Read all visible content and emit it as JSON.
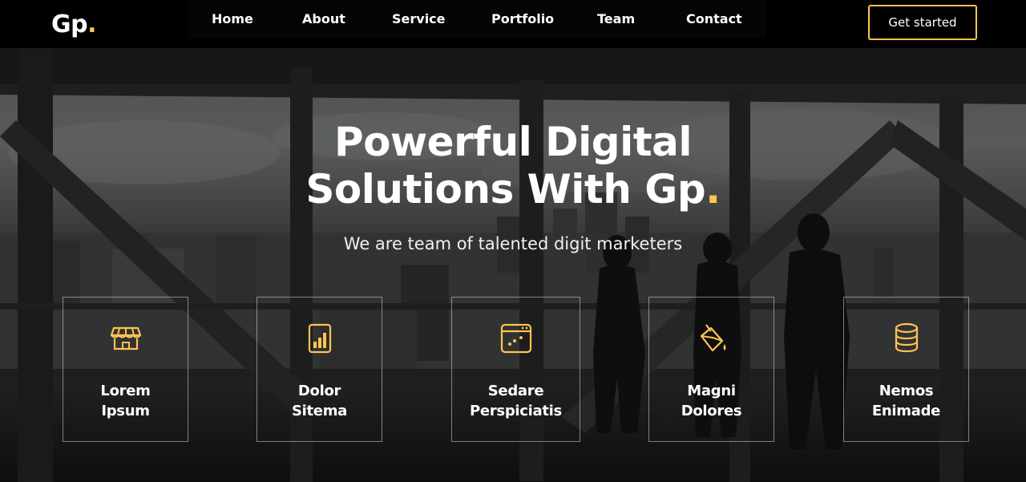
{
  "brand": {
    "logo_text": "Gp",
    "logo_dot": ".",
    "accent_color": "#ffc451"
  },
  "nav": {
    "items": [
      {
        "label": "Home"
      },
      {
        "label": "About"
      },
      {
        "label": "Service"
      },
      {
        "label": "Portfolio"
      },
      {
        "label": "Team"
      },
      {
        "label": "Contact"
      }
    ],
    "cta_label": "Get started"
  },
  "hero": {
    "headline_line1": "Powerful Digital",
    "headline_line2": "Solutions With Gp",
    "headline_dot": ".",
    "subheadline": "We are team of talented digit marketers"
  },
  "features": [
    {
      "icon": "store-icon",
      "line1": "Lorem",
      "line2": "Ipsum"
    },
    {
      "icon": "bar-chart-icon",
      "line1": "Dolor",
      "line2": "Sitema"
    },
    {
      "icon": "calendar-todo-icon",
      "line1": "Sedare",
      "line2": "Perspiciatis"
    },
    {
      "icon": "paint-bucket-icon",
      "line1": "Magni",
      "line2": "Dolores"
    },
    {
      "icon": "database-icon",
      "line1": "Nemos",
      "line2": "Enimade"
    }
  ]
}
